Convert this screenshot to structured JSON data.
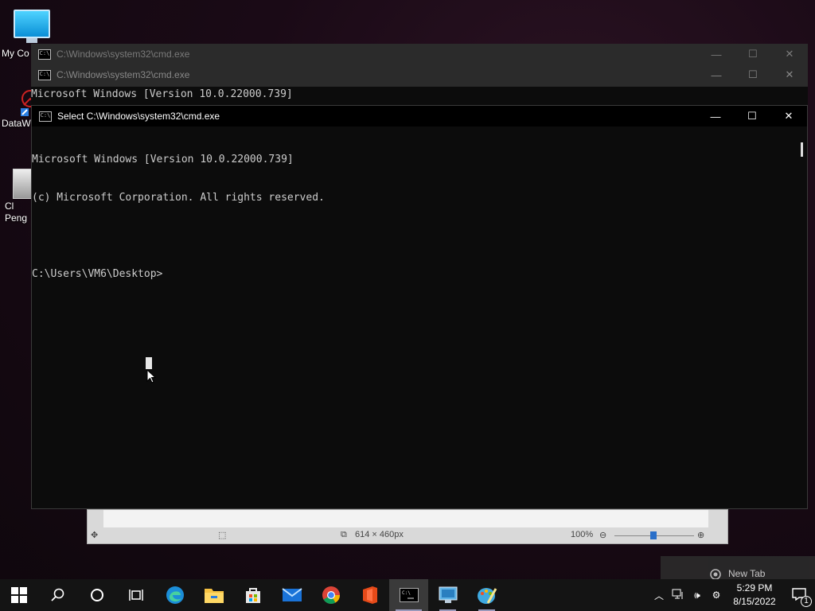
{
  "desktop": {
    "icons": [
      {
        "label": "My Co",
        "name": "this-pc"
      },
      {
        "label": "DataW",
        "name": "datawrapper"
      },
      {
        "label": "Cl\nPeng",
        "name": "doc-file"
      }
    ]
  },
  "windows": {
    "back1": {
      "title": "C:\\Windows\\system32\\cmd.exe"
    },
    "back2": {
      "title": "C:\\Windows\\system32\\cmd.exe",
      "peek_line": "Microsoft Windows [Version 10.0.22000.739]"
    },
    "main": {
      "title": "Select C:\\Windows\\system32\\cmd.exe",
      "lines": [
        "Microsoft Windows [Version 10.0.22000.739]",
        "(c) Microsoft Corporation. All rights reserved.",
        "",
        "C:\\Users\\VM6\\Desktop>"
      ]
    }
  },
  "image_editor": {
    "dimensions": "614 × 460px",
    "zoom": "100%"
  },
  "notification": {
    "label": "New Tab"
  },
  "taskbar": {
    "apps": [
      "start",
      "search",
      "cortana",
      "task-view",
      "edge",
      "file-explorer",
      "store",
      "mail",
      "chrome",
      "office",
      "cmd",
      "control-panel",
      "paint"
    ],
    "clock": {
      "time": "5:29 PM",
      "date": "8/15/2022"
    },
    "notification_count": "1"
  },
  "colors": {
    "console_bg": "#0c0c0c",
    "console_fg": "#cccccc",
    "taskbar_bg": "#141414"
  }
}
